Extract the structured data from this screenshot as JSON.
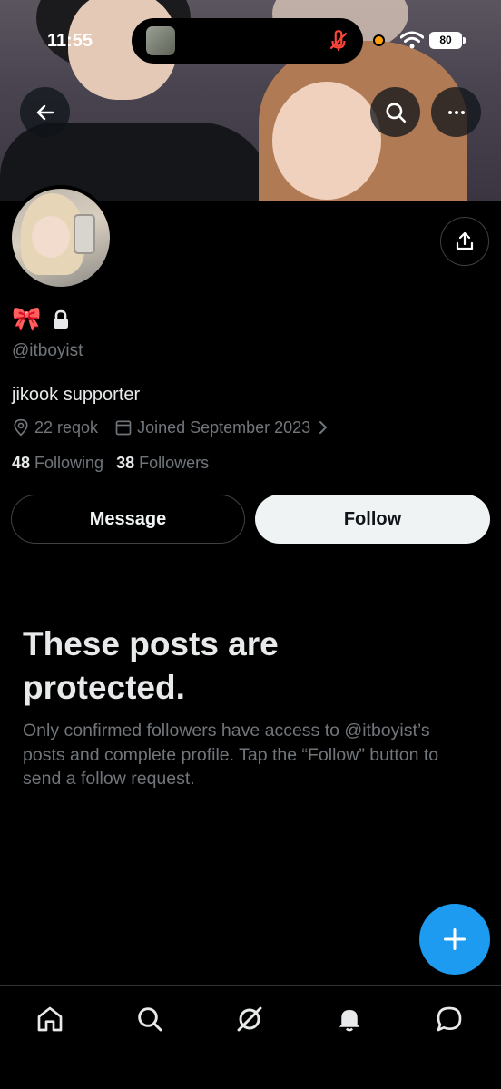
{
  "status_bar": {
    "time": "11:55",
    "battery": "80"
  },
  "profile": {
    "name_emoji": "🎀",
    "handle": "@itboyist",
    "bio": "jikook supporter",
    "location": "22 reqok",
    "joined": "Joined September 2023",
    "following_count": "48",
    "following_label": "Following",
    "followers_count": "38",
    "followers_label": "Followers"
  },
  "actions": {
    "message_label": "Message",
    "follow_label": "Follow"
  },
  "protected": {
    "title": "These posts are protected.",
    "body": "Only confirmed followers have access to @itboyist’s posts and complete profile. Tap the “Follow” button to send a follow request."
  },
  "icons": {
    "back": "arrow-left-icon",
    "search": "search-icon",
    "more": "more-icon",
    "share": "share-icon",
    "lock": "lock-icon",
    "location": "location-pin-icon",
    "calendar": "calendar-icon",
    "compose": "plus-icon",
    "tabs": [
      "home-icon",
      "search-icon",
      "grok-icon",
      "bell-icon",
      "chat-icon"
    ]
  },
  "colors": {
    "accent": "#1d9bf0",
    "background": "#000000",
    "secondary_text": "#71767b",
    "follow_button": "#eff3f4"
  }
}
